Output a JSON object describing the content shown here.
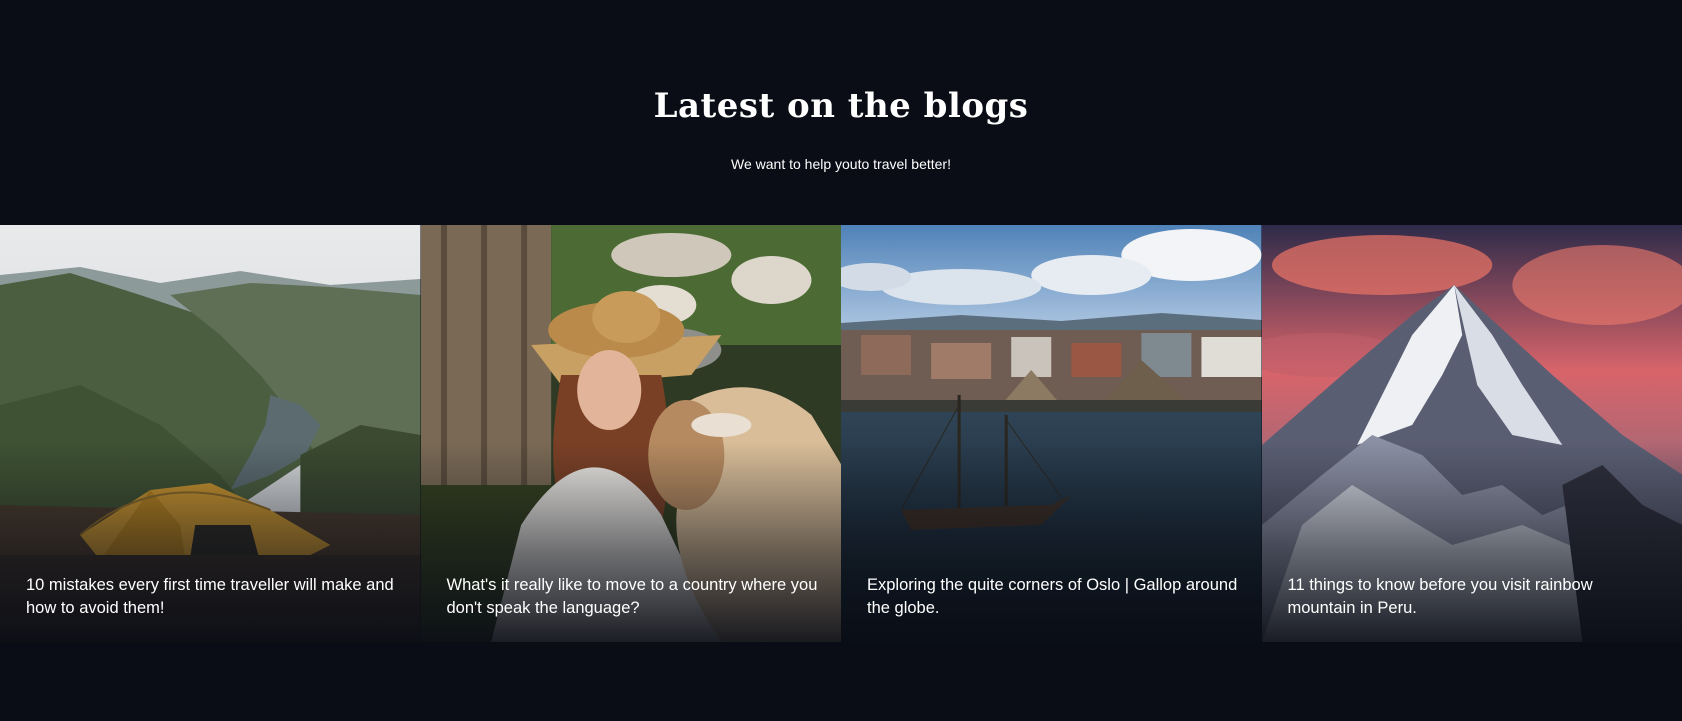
{
  "section": {
    "title": "Latest on the blogs",
    "subtitle": "We want to help youto travel better!"
  },
  "posts": [
    {
      "title": "10 mistakes every first time traveller will make and how to avoid them!",
      "image_icon": "tent-landscape-photo"
    },
    {
      "title": "What's it really like to move to a country where you don't speak the language?",
      "image_icon": "woman-with-goat-photo"
    },
    {
      "title": "Exploring the quite corners of Oslo | Gallop around the globe.",
      "image_icon": "oslo-harbor-photo"
    },
    {
      "title": "11 things to know before you visit rainbow mountain in Peru.",
      "image_icon": "mountain-peak-photo"
    }
  ],
  "colors": {
    "background": "#0a0d15",
    "text": "#ffffff"
  }
}
